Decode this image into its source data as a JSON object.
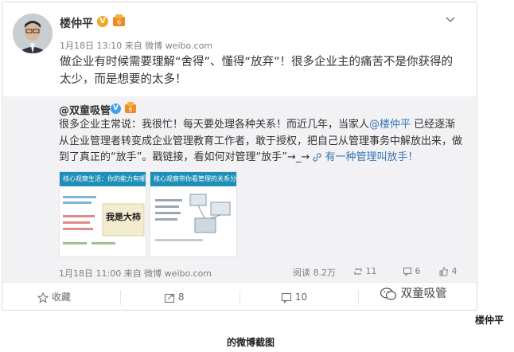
{
  "post": {
    "author": "楼仲平",
    "meta": "1月18日 13:10 来自 微博 weibo.com",
    "text": "做企业有时候需要理解“舍得”、懂得“放弃”！很多企业主的痛苦不是你获得的太少，而是想要的太多！"
  },
  "repost": {
    "author": "@双童吸管",
    "text_a": "很多企业主常说：我很忙！每天要处理各种关系！而近几年，当家人",
    "mention": "@楼仲平",
    "text_b": " 已经逐渐从企业管理者转变成企业管理教育工作者，敢于授权，把自己从管理事务中解放出来，做到了真正的“放手”。戳链接，看如何对管理“放手”→_→ ",
    "link": "有一种管理叫放手！",
    "meta": "1月18日 11:00 来自 微博 weibo.com",
    "views": "阅读 8.2万",
    "reposts": "11",
    "comments": "6",
    "likes": "4",
    "thumb1_bar": "核心观察生活：你的能力有哪些？",
    "thumb1_art": "我是大柿",
    "thumb2_bar": "核心观察带你看管理的关系分析"
  },
  "footer": {
    "favorite": "收藏",
    "repost": "8",
    "comment": "10"
  },
  "watermark": "双童吸管",
  "caption": {
    "line1": "楼仲平",
    "line2": "的微博截图"
  },
  "colors": {
    "link": "#3b74b5",
    "quote_bg": "#f2f2f5",
    "badge_orange": "#f5a623"
  }
}
